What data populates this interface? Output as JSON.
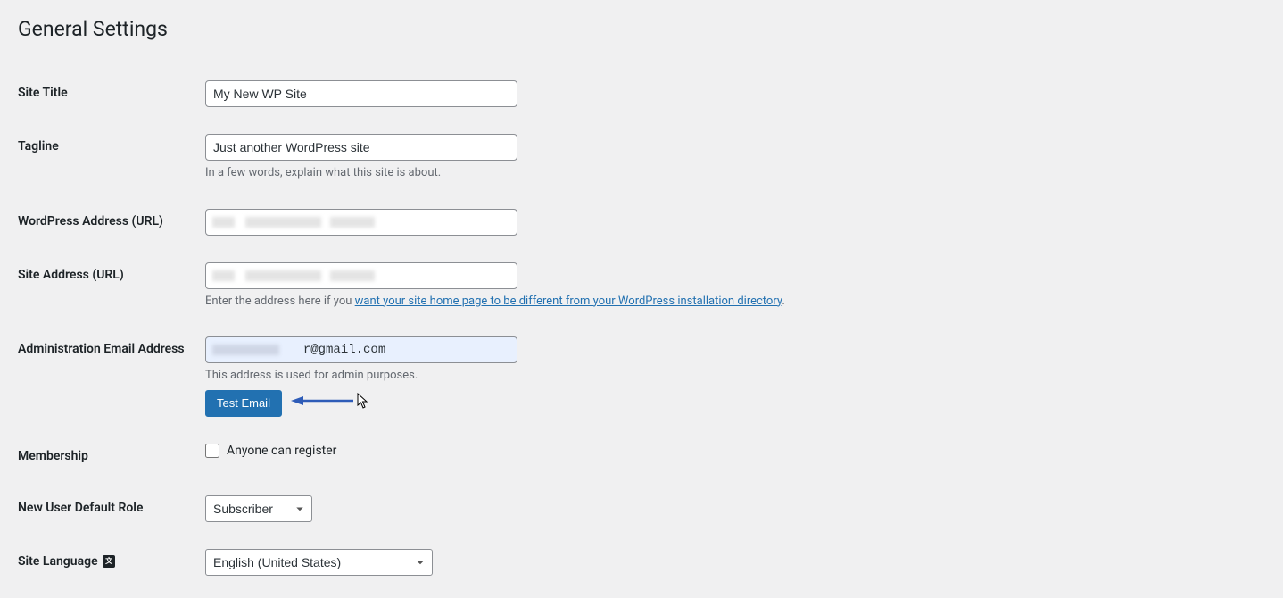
{
  "page_title": "General Settings",
  "fields": {
    "site_title": {
      "label": "Site Title",
      "value": "My New WP Site"
    },
    "tagline": {
      "label": "Tagline",
      "value": "Just another WordPress site",
      "description": "In a few words, explain what this site is about."
    },
    "wp_address": {
      "label": "WordPress Address (URL)",
      "value": ""
    },
    "site_address": {
      "label": "Site Address (URL)",
      "value": "",
      "description_prefix": "Enter the address here if you ",
      "description_link": "want your site home page to be different from your WordPress installation directory",
      "description_suffix": "."
    },
    "admin_email": {
      "label": "Administration Email Address",
      "value": "            r@gmail.com",
      "description": "This address is used for admin purposes.",
      "button": "Test Email"
    },
    "membership": {
      "label": "Membership",
      "checkbox_label": "Anyone can register"
    },
    "default_role": {
      "label": "New User Default Role",
      "value": "Subscriber"
    },
    "site_language": {
      "label": "Site Language",
      "value": "English (United States)"
    }
  }
}
